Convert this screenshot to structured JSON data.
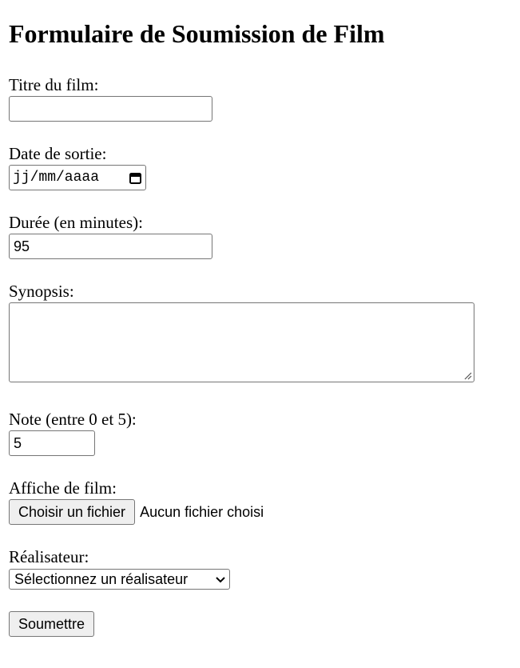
{
  "form": {
    "title": "Formulaire de Soumission de Film",
    "title_label": "Titre du film:",
    "title_value": "",
    "release_label": "Date de sortie:",
    "release_placeholder": "jj/mm/aaaa",
    "duration_label": "Durée (en minutes):",
    "duration_value": "95",
    "synopsis_label": "Synopsis:",
    "synopsis_value": "",
    "rating_label": "Note (entre 0 et 5):",
    "rating_value": "5",
    "poster_label": "Affiche de film:",
    "poster_button": "Choisir un fichier",
    "poster_status": "Aucun fichier choisi",
    "director_label": "Réalisateur:",
    "director_selected": "Sélectionnez un réalisateur",
    "submit_label": "Soumettre"
  },
  "icons": {
    "date_picker": "calendar-icon",
    "select_arrow": "chevron-down-icon",
    "resize": "resize-grip-icon"
  },
  "colors": {
    "border": "#767676",
    "button_bg": "#efefef",
    "text": "#000000",
    "background": "#ffffff"
  }
}
